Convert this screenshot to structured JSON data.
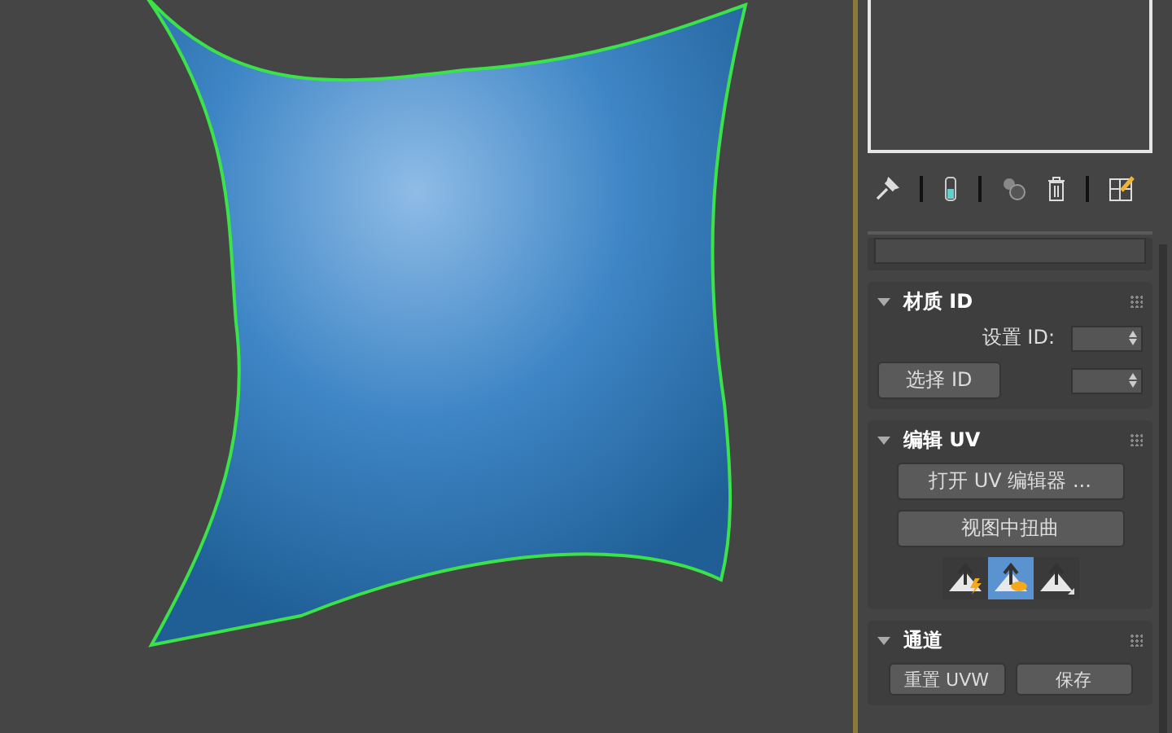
{
  "rollouts": [
    {
      "kind": "material_id",
      "title": "材质 ID",
      "expanded": true,
      "set_id_label": "设置 ID:",
      "select_button": "选择 ID"
    },
    {
      "kind": "edit_uv",
      "title": "编辑 UV",
      "expanded": true,
      "open_button": "打开 UV 编辑器 ...",
      "tweak_button": "视图中扭曲",
      "tools": [
        {
          "selected": false
        },
        {
          "selected": true
        },
        {
          "selected": false
        }
      ]
    },
    {
      "kind": "channel",
      "title": "通道",
      "expanded": true,
      "buttons": [
        "重置 UVW",
        "保存"
      ]
    }
  ]
}
